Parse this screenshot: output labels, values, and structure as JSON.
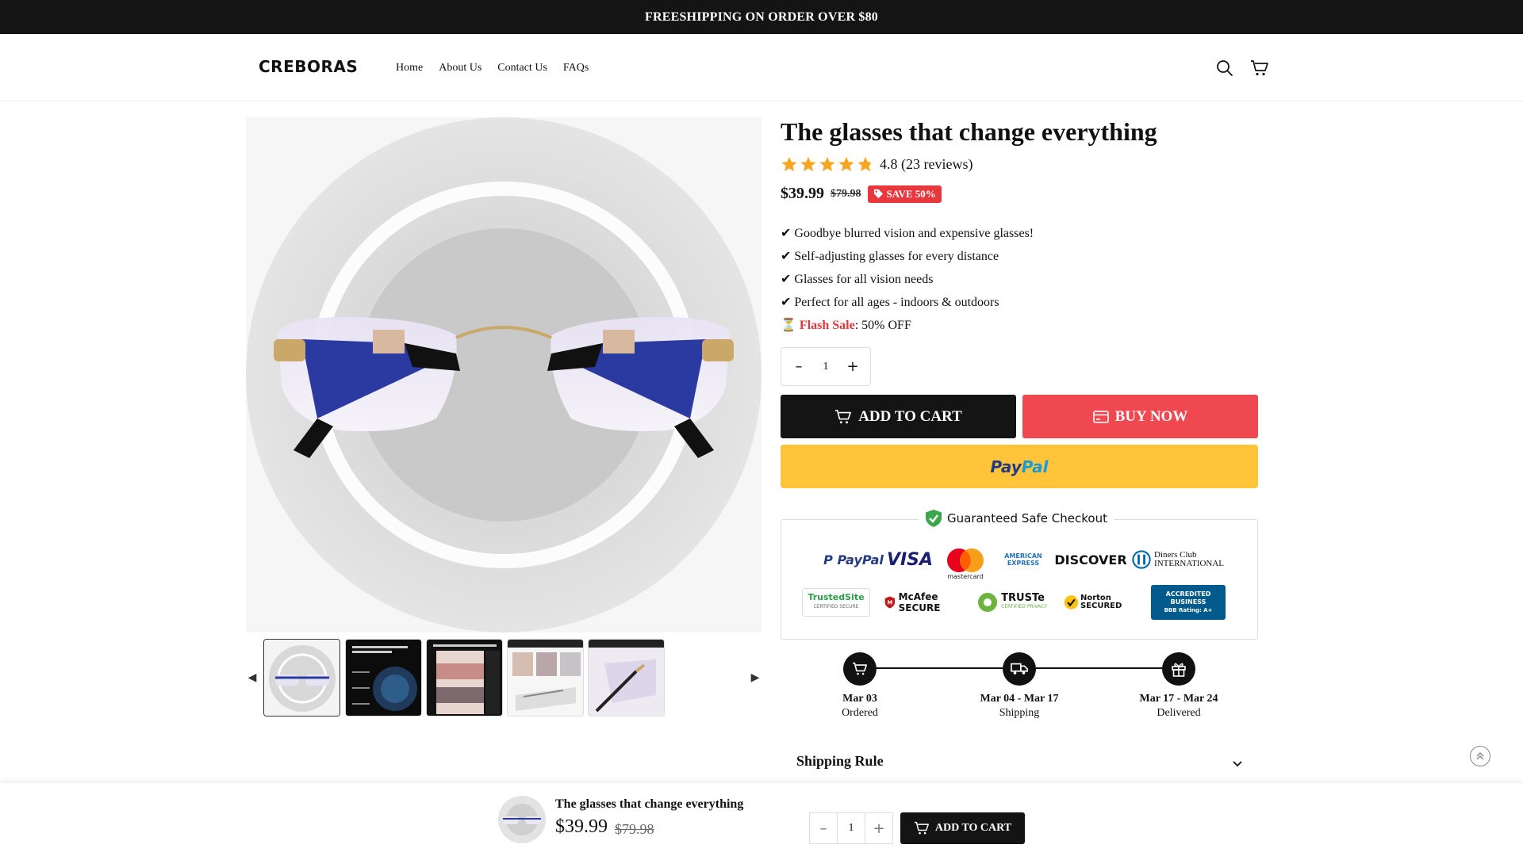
{
  "announcement": "FREESHIPPING ON ORDER OVER $80",
  "header": {
    "logo_text": "CREBORAS",
    "nav": [
      "Home",
      "About Us",
      "Contact Us",
      "FAQs"
    ],
    "icons": [
      "search-icon",
      "cart-icon"
    ]
  },
  "product": {
    "title": "The glasses that change everything",
    "rating_value": "4.8",
    "rating_text": "4.8 (23 reviews)",
    "stars": 4.8,
    "price": "$39.99",
    "compare_price": "$79.98",
    "save_badge": "SAVE 50%",
    "bullets": [
      "✔ Goodbye blurred vision and expensive glasses!",
      "✔ Self-adjusting glasses for every distance",
      "✔ Glasses for all vision needs",
      "✔ Perfect for all ages - indoors & outdoors"
    ],
    "flash_icon": "⏳",
    "flash_label": "Flash Sale",
    "flash_rest": ": 50% OFF",
    "quantity": "1",
    "add_to_cart": "ADD TO CART",
    "buy_now": "BUY NOW",
    "paypal_label": "PayPal"
  },
  "gallery": {
    "thumbnail_count": 5,
    "active_index": 0
  },
  "trust": {
    "title": "Guaranteed Safe Checkout",
    "payment_logos": [
      "PayPal",
      "VISA",
      "mastercard",
      "AMERICAN EXPRESS",
      "DISCOVER",
      "Diners Club INTERNATIONAL"
    ],
    "security_logos": [
      "TrustedSite",
      "McAfee SECURE",
      "TRUSTe",
      "Norton SECURED",
      "ACCREDITED BUSINESS"
    ],
    "security_sublabels": [
      "CERTIFIED SECURE",
      "CERTIFIED PRIVACY",
      "BBB Rating: A+"
    ]
  },
  "shipping_timeline": [
    {
      "date": "Mar 03",
      "label": "Ordered",
      "icon": "cart-icon"
    },
    {
      "date": "Mar 04 - Mar 17",
      "label": "Shipping",
      "icon": "truck-icon"
    },
    {
      "date": "Mar 17 - Mar 24",
      "label": "Delivered",
      "icon": "gift-icon"
    }
  ],
  "shipping_rule": "Shipping Rule",
  "sticky_bar": {
    "title": "The glasses that change everything",
    "price": "$39.99",
    "compare_price": "$79.98",
    "quantity": "1",
    "add_to_cart": "ADD TO CART"
  },
  "colors": {
    "accent_red": "#e2373c",
    "buy_now": "#ef4850",
    "paypal_yellow": "#ffc43a",
    "dark": "#141414",
    "star": "#f5a623"
  }
}
